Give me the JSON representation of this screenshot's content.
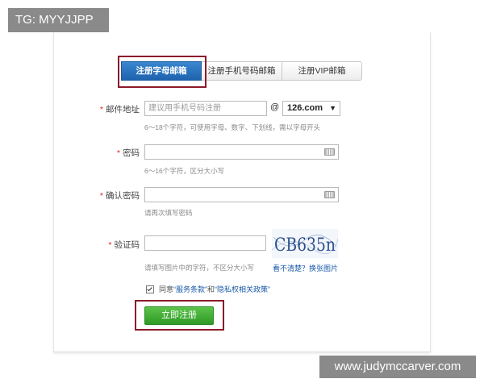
{
  "watermarks": {
    "top_left": "TG: MYYJJPP",
    "bottom_right": "www.judymccarver.com"
  },
  "tabs": [
    {
      "label": "注册字母邮箱",
      "active": true
    },
    {
      "label": "注册手机号码邮箱",
      "active": false
    },
    {
      "label": "注册VIP邮箱",
      "active": false
    }
  ],
  "form": {
    "email": {
      "label": "邮件地址",
      "placeholder": "建议用手机号码注册",
      "at": "@",
      "domain": "126.com",
      "hint": "6～18个字符，可使用字母、数字、下划线，需以字母开头"
    },
    "password": {
      "label": "密码",
      "hint": "6～16个字符，区分大小写"
    },
    "confirm_password": {
      "label": "确认密码",
      "hint": "请再次填写密码"
    },
    "captcha": {
      "label": "验证码",
      "image_text": "CB635n",
      "hint": "请填写图片中的字符，不区分大小写",
      "refresh_link": "看不清楚？换张图片"
    },
    "agreement": {
      "prefix": "同意",
      "terms_link": "“服务条款”",
      "and": "和",
      "privacy_link": "“隐私权相关政策”"
    },
    "submit_label": "立即注册"
  },
  "colors": {
    "active_tab": "#1e63ad",
    "submit_green": "#3aa82e",
    "highlight_border": "#8b1a2a",
    "link_blue": "#1a5aa8",
    "required_star": "#e02020"
  }
}
